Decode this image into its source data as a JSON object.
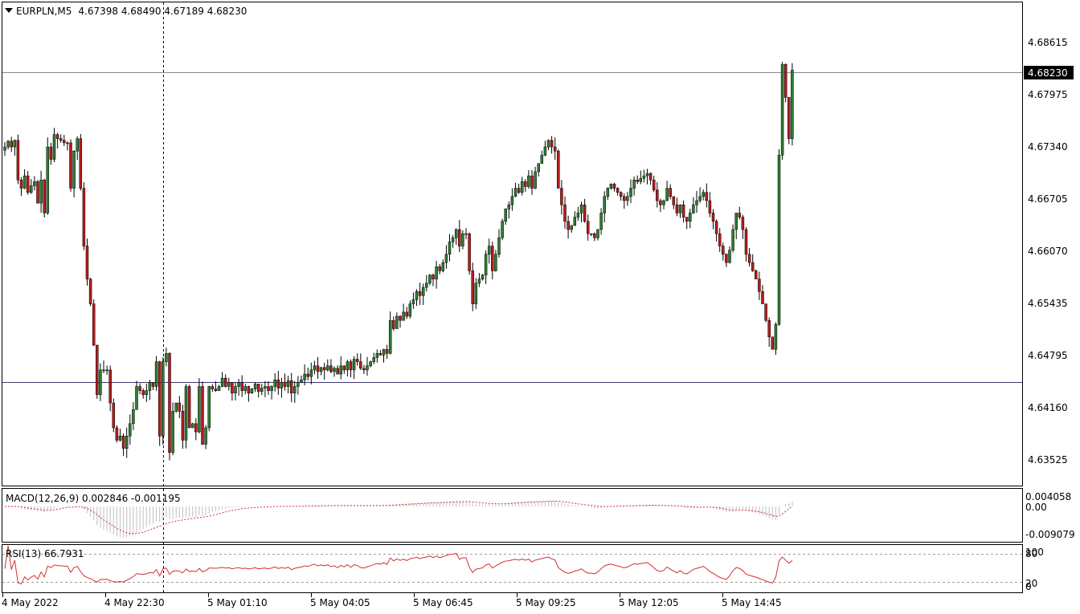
{
  "header": {
    "symbol": "EURPLN,M5",
    "ohlc": "4.67398 4.68490 4.67189 4.68230"
  },
  "price_axis": {
    "ticks": [
      "4.68615",
      "4.67975",
      "4.67340",
      "4.66705",
      "4.66070",
      "4.65435",
      "4.64795",
      "4.64160",
      "4.63525"
    ],
    "current": "4.68230"
  },
  "macd": {
    "label": "MACD(12,26,9) 0.002846 -0.001195",
    "ticks": [
      "0.004058",
      "0.00",
      "-0.009079"
    ]
  },
  "rsi": {
    "label": "RSI(13) 66.7931",
    "ticks": [
      "100",
      "80",
      "20",
      "0"
    ]
  },
  "time_axis": {
    "ticks": [
      "4 May 2022",
      "4 May 22:30",
      "5 May 01:10",
      "5 May 04:05",
      "5 May 06:45",
      "5 May 09:25",
      "5 May 12:05",
      "5 May 14:45"
    ]
  },
  "colors": {
    "up": "#2e7d32",
    "down": "#b71c1c",
    "macd_hist": "#c0c0c0",
    "macd_signal": "#d32f2f",
    "rsi_line": "#d32f2f",
    "border": "#000000"
  },
  "chart_data": {
    "type": "candlestick",
    "symbol": "EURPLN",
    "timeframe": "M5",
    "ylim": [
      4.632,
      4.6905
    ],
    "horizontal_levels": [
      4.6823,
      4.645
    ],
    "crosshair_time": "4 May 22:30",
    "closes": [
      4.673,
      4.6737,
      4.673,
      4.6738,
      4.669,
      4.668,
      4.6695,
      4.6675,
      4.6683,
      4.6688,
      4.6662,
      4.669,
      4.665,
      4.673,
      4.6715,
      4.6745,
      4.674,
      4.6738,
      4.6735,
      4.6735,
      4.668,
      4.6725,
      4.674,
      4.668,
      4.661,
      4.657,
      4.654,
      4.649,
      4.643,
      4.646,
      4.646,
      4.646,
      4.642,
      4.639,
      4.6375,
      4.638,
      4.6365,
      4.638,
      4.6395,
      4.6412,
      4.644,
      4.6435,
      4.643,
      4.6435,
      4.6445,
      4.644,
      4.647,
      4.638,
      4.647,
      4.648,
      4.636,
      4.641,
      4.642,
      4.641,
      4.6375,
      4.644,
      4.639,
      4.6395,
      4.6385,
      4.644,
      4.637,
      4.639,
      4.644,
      4.6437,
      4.6435,
      4.644,
      4.645,
      4.644,
      4.6445,
      4.6432,
      4.644,
      4.6445,
      4.6435,
      4.644,
      4.6432,
      4.6437,
      4.6443,
      4.6434,
      4.6438,
      4.644,
      4.6435,
      4.644,
      4.6448,
      4.6438,
      4.6445,
      4.644,
      4.6447,
      4.6432,
      4.644,
      4.6445,
      4.6448,
      4.6455,
      4.6452,
      4.646,
      4.6465,
      4.6458,
      4.6463,
      4.646,
      4.6465,
      4.6458,
      4.6462,
      4.6455,
      4.6465,
      4.646,
      4.647,
      4.646,
      4.6473,
      4.647,
      4.6462,
      4.646,
      4.6465,
      4.647,
      4.6475,
      4.648,
      4.6478,
      4.6485,
      4.648,
      4.652,
      4.651,
      4.6525,
      4.652,
      4.653,
      4.6525,
      4.654,
      4.6545,
      4.6555,
      4.655,
      4.656,
      4.6565,
      4.6575,
      4.657,
      4.6585,
      4.658,
      4.659,
      4.66,
      4.6615,
      4.662,
      4.663,
      4.661,
      4.6625,
      4.6625,
      4.658,
      4.654,
      4.6565,
      4.657,
      4.6575,
      4.66,
      4.661,
      4.658,
      4.66,
      4.662,
      4.664,
      4.6655,
      4.666,
      4.667,
      4.668,
      4.6675,
      4.6688,
      4.6682,
      4.6695,
      4.668,
      4.67,
      4.671,
      4.672,
      4.673,
      4.6738,
      4.673,
      4.6725,
      4.668,
      4.666,
      4.664,
      4.663,
      4.6635,
      4.6645,
      4.665,
      4.666,
      4.664,
      4.6625,
      4.6625,
      4.662,
      4.663,
      4.665,
      4.667,
      4.668,
      4.6685,
      4.668,
      4.6675,
      4.667,
      4.6665,
      4.667,
      4.668,
      4.669,
      4.6688,
      4.6692,
      4.6695,
      4.6698,
      4.669,
      4.6678,
      4.6665,
      4.666,
      4.6665,
      4.668,
      4.667,
      4.666,
      4.665,
      4.666,
      4.6645,
      4.664,
      4.665,
      4.666,
      4.6665,
      4.667,
      4.6675,
      4.6665,
      4.665,
      4.664,
      4.6625,
      4.661,
      4.66,
      4.659,
      4.6605,
      4.663,
      4.665,
      4.6645,
      4.663,
      4.66,
      4.659,
      4.658,
      4.657,
      4.6555,
      4.654,
      4.652,
      4.65,
      4.6485,
      4.6515,
      4.672,
      4.683,
      4.679,
      4.674,
      4.6823
    ]
  }
}
